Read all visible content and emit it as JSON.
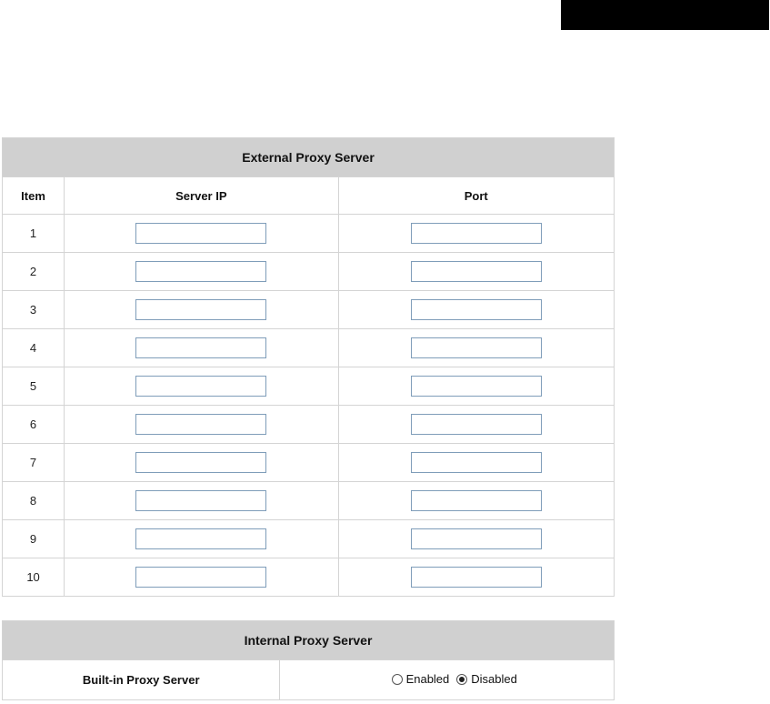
{
  "external": {
    "title": "External Proxy Server",
    "headers": {
      "item": "Item",
      "server_ip": "Server IP",
      "port": "Port"
    },
    "rows": [
      {
        "item": "1",
        "server_ip": "",
        "port": ""
      },
      {
        "item": "2",
        "server_ip": "",
        "port": ""
      },
      {
        "item": "3",
        "server_ip": "",
        "port": ""
      },
      {
        "item": "4",
        "server_ip": "",
        "port": ""
      },
      {
        "item": "5",
        "server_ip": "",
        "port": ""
      },
      {
        "item": "6",
        "server_ip": "",
        "port": ""
      },
      {
        "item": "7",
        "server_ip": "",
        "port": ""
      },
      {
        "item": "8",
        "server_ip": "",
        "port": ""
      },
      {
        "item": "9",
        "server_ip": "",
        "port": ""
      },
      {
        "item": "10",
        "server_ip": "",
        "port": ""
      }
    ]
  },
  "internal": {
    "title": "Internal Proxy Server",
    "builtin_label": "Built-in Proxy Server",
    "options": [
      {
        "label": "Enabled",
        "checked": false
      },
      {
        "label": "Disabled",
        "checked": true
      }
    ]
  },
  "colors": {
    "title_bar": "#d0d0d0",
    "input_border": "#7f9db9",
    "top_right_box": "#000000"
  }
}
